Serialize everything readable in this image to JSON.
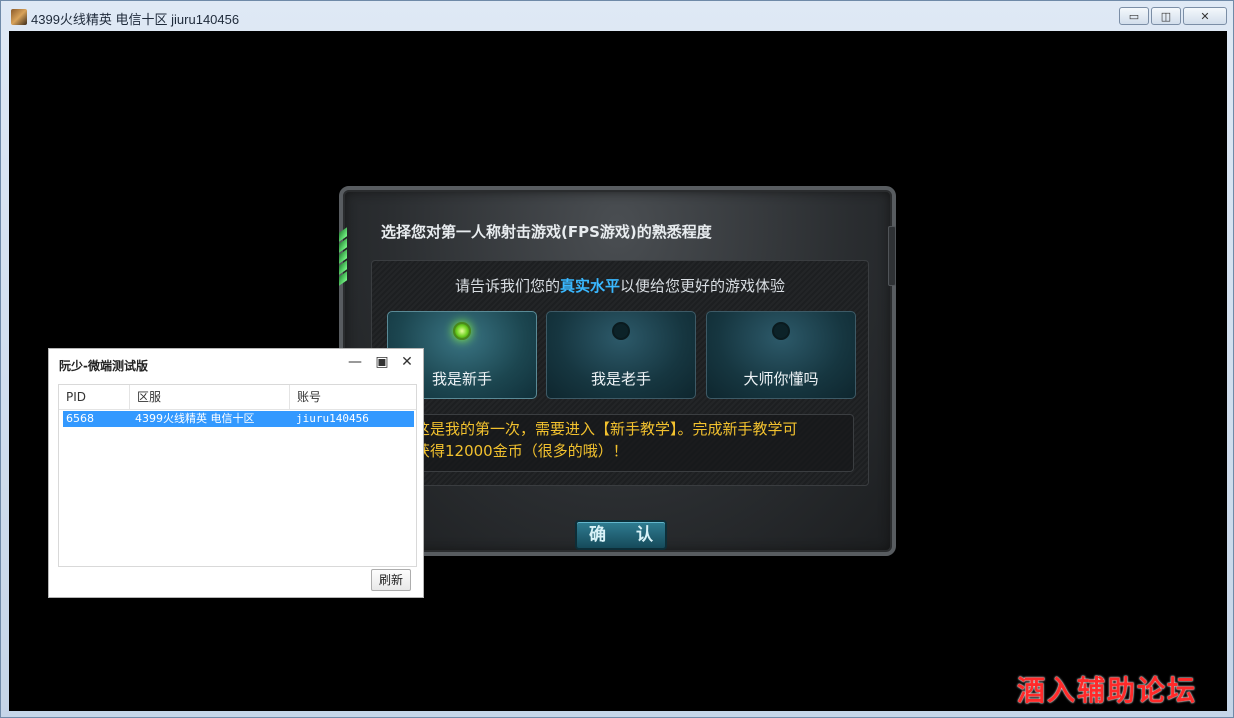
{
  "window": {
    "title": "4399火线精英 电信十区 jiuru140456",
    "controls": [
      "minimize",
      "maximize",
      "close"
    ],
    "minimize_glyph": "▭",
    "maximize_glyph": "◫",
    "close_glyph": "✕"
  },
  "dialog": {
    "title": "选择您对第一人称射击游戏(FPS游戏)的熟悉程度",
    "prompt_before": "请告诉我们您的",
    "prompt_highlight": "真实水平",
    "prompt_after": "以便给您更好的游戏体验",
    "options": [
      {
        "label": "我是新手",
        "selected": true
      },
      {
        "label": "我是老手",
        "selected": false
      },
      {
        "label": "大师你懂吗",
        "selected": false
      }
    ],
    "description_line1": "这是我的第一次，需要进入【新手教学】。完成新手教学可",
    "description_line2": "获得12000金币（很多的哦）！",
    "confirm_label": "确 认",
    "accent_color": "#3ab8ff",
    "description_color": "#f2c12e"
  },
  "tool_window": {
    "title": "阮少-微端测试版",
    "minimize_glyph": "—",
    "maximize_glyph": "▣",
    "close_glyph": "✕",
    "columns": [
      "PID",
      "区服",
      "账号"
    ],
    "rows": [
      {
        "pid": "6568",
        "server": "4399火线精英 电信十区",
        "account": "jiuru140456"
      }
    ],
    "refresh_label": "刷新",
    "selection_color": "#3399ff"
  },
  "watermark": "酒入辅助论坛"
}
